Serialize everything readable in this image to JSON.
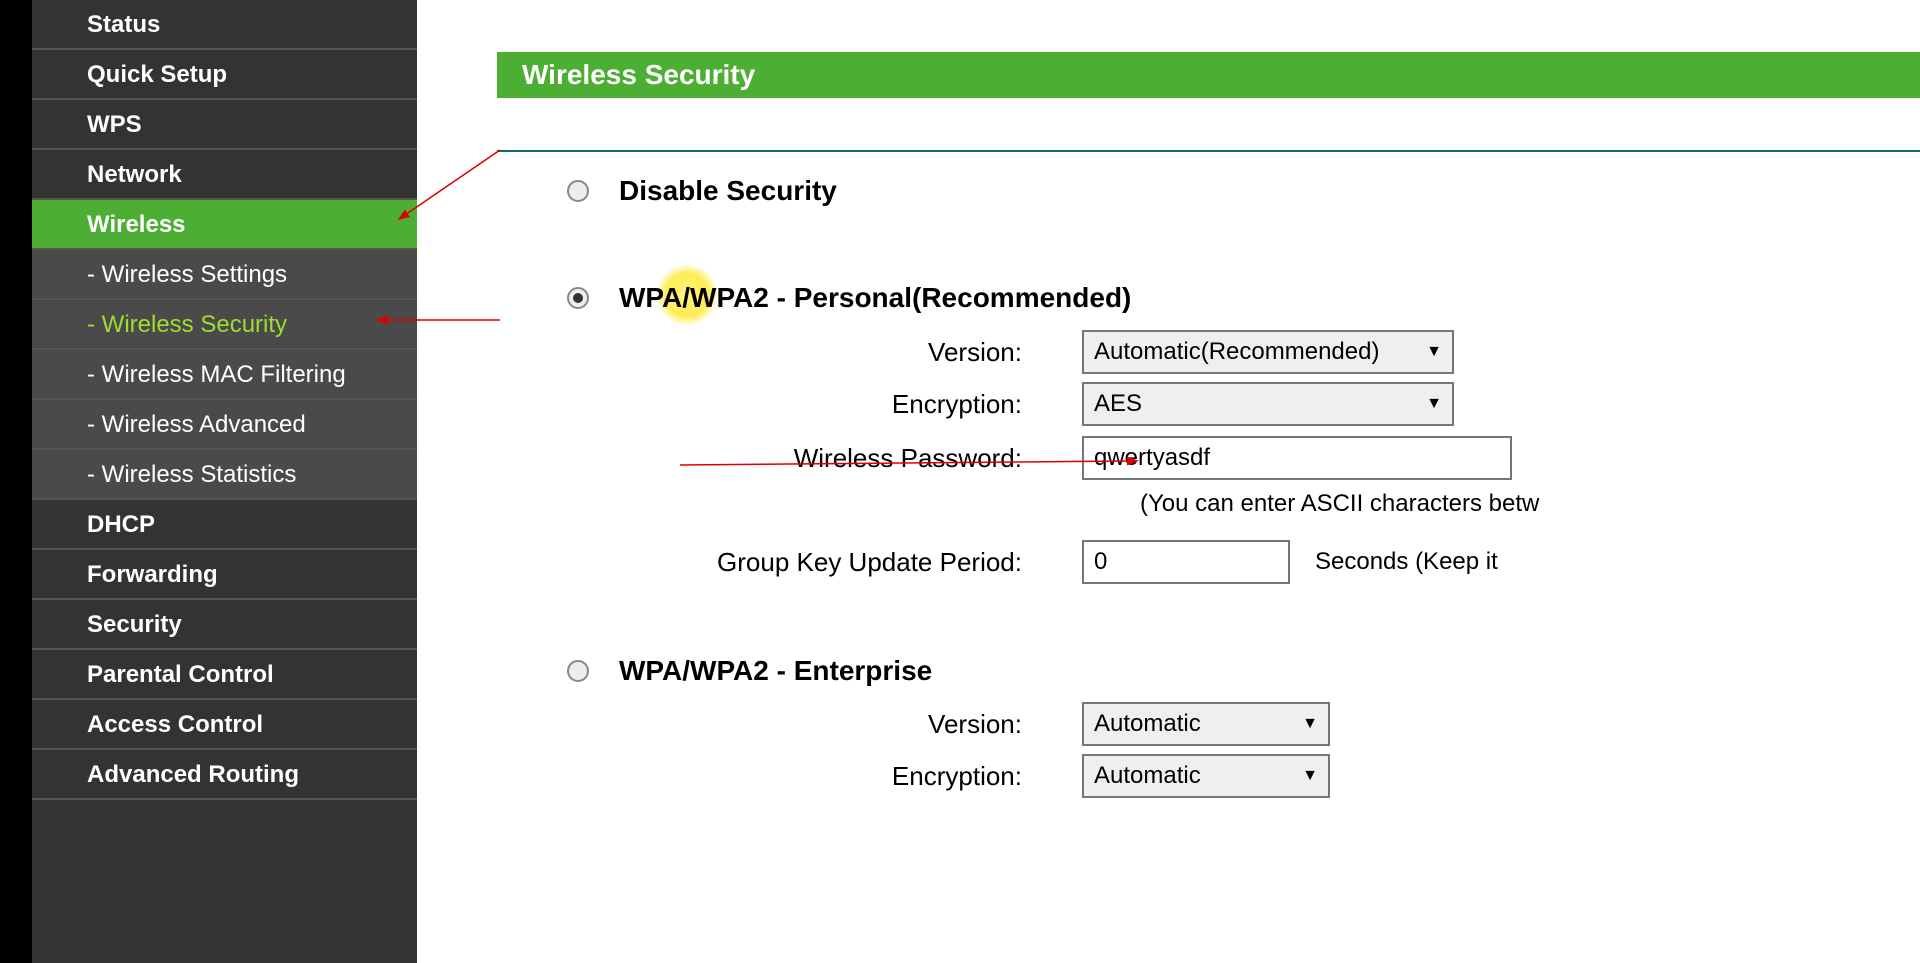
{
  "sidebar": {
    "items": [
      {
        "label": "Status"
      },
      {
        "label": "Quick Setup"
      },
      {
        "label": "WPS"
      },
      {
        "label": "Network"
      },
      {
        "label": "Wireless"
      }
    ],
    "wireless_sub": [
      {
        "label": "- Wireless Settings"
      },
      {
        "label": "- Wireless Security"
      },
      {
        "label": "- Wireless MAC Filtering"
      },
      {
        "label": "- Wireless Advanced"
      },
      {
        "label": "- Wireless Statistics"
      }
    ],
    "after": [
      {
        "label": "DHCP"
      },
      {
        "label": "Forwarding"
      },
      {
        "label": "Security"
      },
      {
        "label": "Parental Control"
      },
      {
        "label": "Access Control"
      },
      {
        "label": "Advanced Routing"
      }
    ]
  },
  "page": {
    "title": "Wireless Security",
    "disable_label": "Disable Security",
    "wpa_personal_label": "WPA/WPA2 - Personal(Recommended)",
    "wpa_enterprise_label": "WPA/WPA2 - Enterprise",
    "fields": {
      "version_label": "Version:",
      "version_value": "Automatic(Recommended)",
      "encryption_label": "Encryption:",
      "encryption_value": "AES",
      "password_label": "Wireless Password:",
      "password_value": "qwertyasdf",
      "password_hint": "(You can enter ASCII characters betw",
      "group_key_label": "Group Key Update Period:",
      "group_key_value": "0",
      "group_key_hint": "Seconds (Keep it"
    },
    "enterprise": {
      "version_label": "Version:",
      "version_value": "Automatic",
      "encryption_label": "Encryption:",
      "encryption_value": "Automatic"
    }
  }
}
